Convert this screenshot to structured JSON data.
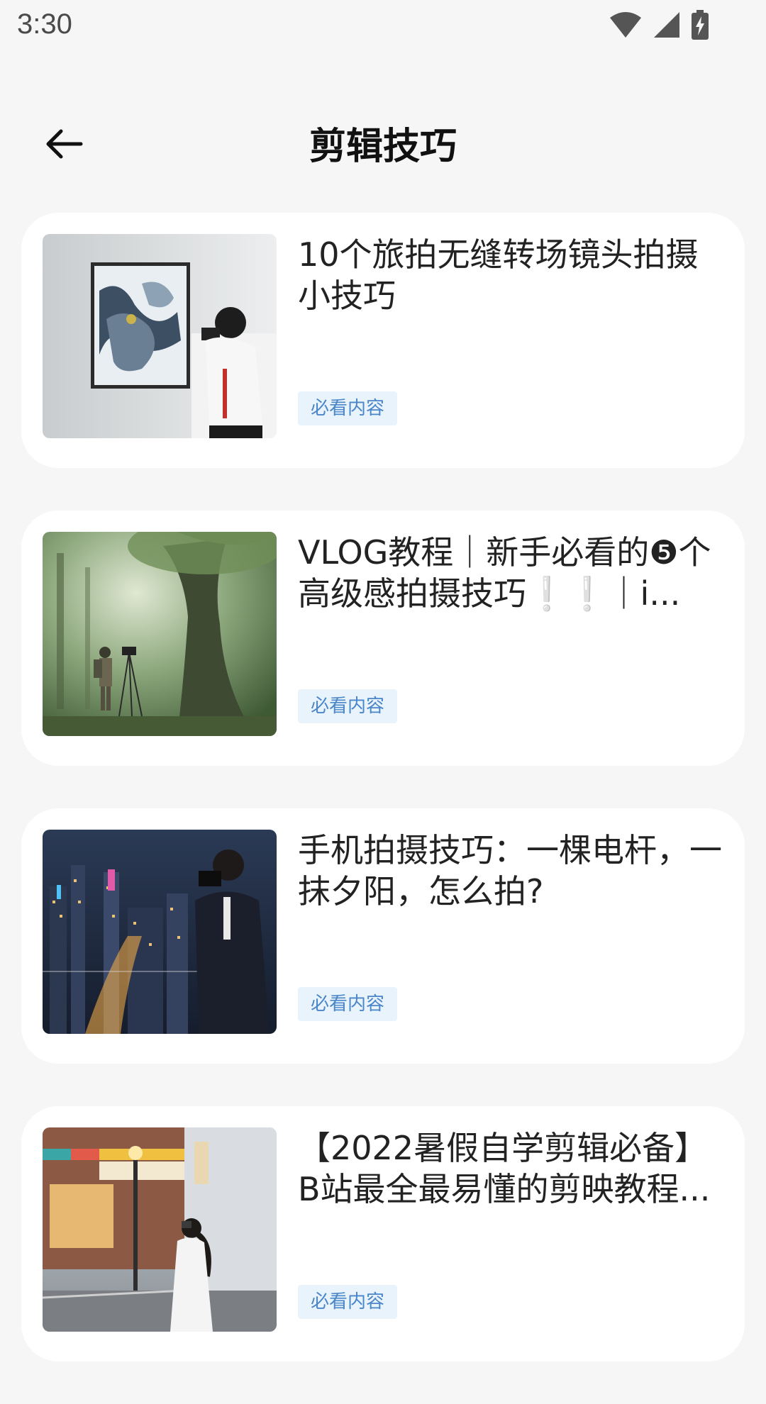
{
  "status_bar": {
    "time": "3:30",
    "icons": [
      "wifi-icon",
      "cellular-signal-icon",
      "battery-charging-icon"
    ]
  },
  "header": {
    "title": "剪辑技巧",
    "back_icon": "arrow-left-icon"
  },
  "articles": [
    {
      "title": "10个旅拍无缝转场镜头拍摄小技巧",
      "tag": "必看内容",
      "thumbnail": "photographer-in-gallery-image"
    },
    {
      "title": "VLOG教程｜新手必看的❺个高级感拍摄技巧❕❕｜i...",
      "tag": "必看内容",
      "thumbnail": "photographer-in-forest-image"
    },
    {
      "title": "手机拍摄技巧：一棵电杆，一抹夕阳，怎么拍?",
      "tag": "必看内容",
      "thumbnail": "photographer-city-night-image"
    },
    {
      "title": "【2022暑假自学剪辑必备】B站最全最易懂的剪映教程...",
      "tag": "必看内容",
      "thumbnail": "girl-photographing-street-image"
    }
  ],
  "colors": {
    "background": "#f6f6f6",
    "card": "#ffffff",
    "tag_text": "#4a86c8",
    "tag_bg": "#e8f3fc"
  }
}
